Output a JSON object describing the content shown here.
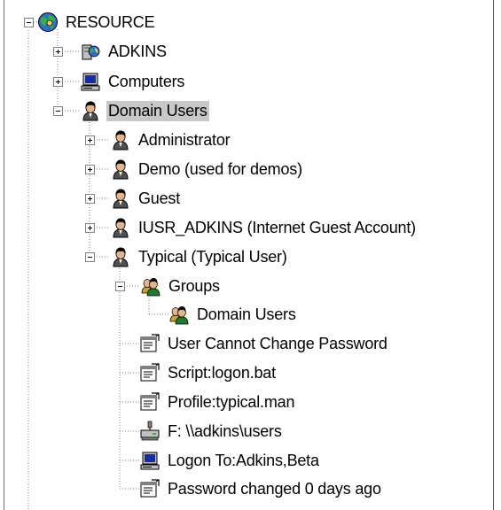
{
  "tree": {
    "root": {
      "label": "RESOURCE",
      "icon": "globe-icon"
    },
    "adkins": {
      "label": "ADKINS",
      "icon": "server-icon"
    },
    "computers": {
      "label": "Computers",
      "icon": "computer-icon"
    },
    "domain_users": {
      "label": "Domain Users",
      "icon": "user-icon"
    },
    "users": [
      {
        "label": "Administrator",
        "icon": "user-icon"
      },
      {
        "label": "Demo (used for demos)",
        "icon": "user-icon"
      },
      {
        "label": "Guest",
        "icon": "user-icon"
      },
      {
        "label": "IUSR_ADKINS (Internet Guest Account)",
        "icon": "user-icon"
      },
      {
        "label": "Typical (Typical User)",
        "icon": "user-icon"
      }
    ],
    "groups": {
      "label": "Groups",
      "icon": "group-icon"
    },
    "group_domain_users": {
      "label": "Domain Users",
      "icon": "group-icon"
    },
    "properties": [
      {
        "label": "User Cannot Change Password",
        "icon": "property-icon"
      },
      {
        "label": "Script:logon.bat",
        "icon": "property-icon"
      },
      {
        "label": "Profile:typical.man",
        "icon": "property-icon"
      },
      {
        "label": "F: \\\\adkins\\users",
        "icon": "network-drive-icon"
      },
      {
        "label": "Logon To:Adkins,Beta",
        "icon": "computer-icon"
      },
      {
        "label": "Password changed 0 days ago",
        "icon": "property-icon"
      }
    ]
  }
}
